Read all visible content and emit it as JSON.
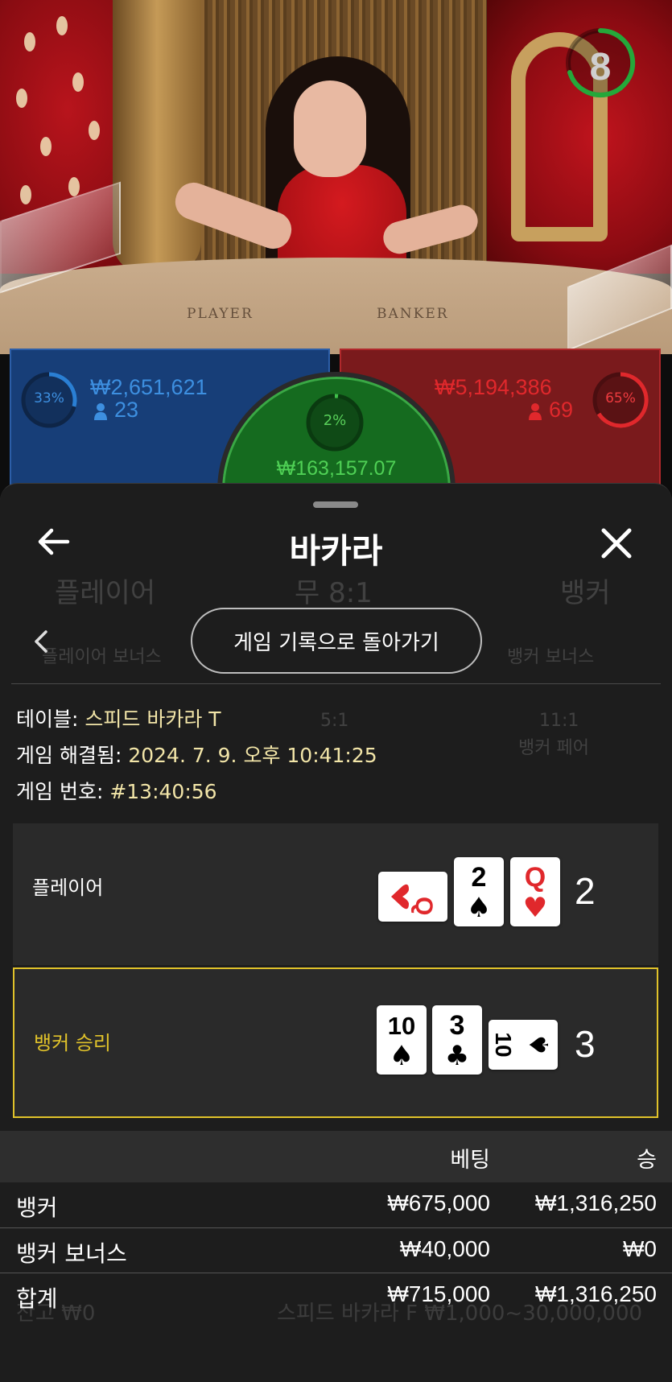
{
  "scene": {
    "timer_value": "8",
    "table_labels": [
      "PLAYER",
      "BANKER"
    ]
  },
  "bets": {
    "player": {
      "percent": "33%",
      "amount": "₩2,651,621",
      "count": "23",
      "color": "#2a7fd4"
    },
    "banker": {
      "percent": "65%",
      "amount": "₩5,194,386",
      "count": "69",
      "color": "#e0282c"
    },
    "tie": {
      "percent": "2%",
      "amount": "₩163,157.07",
      "color": "#3fc04a"
    }
  },
  "background_ghost": {
    "player": "플레이어",
    "tie": "무 8:1",
    "banker": "뱅커",
    "player_bonus": "플레이어 보너스",
    "banker_bonus": "뱅커 보너스",
    "odds_mid": "5:1",
    "odds_right": "11:1",
    "banker_pair": "뱅커 페어",
    "footer_left": "잔고 ₩0",
    "footer_right": "스피드 바카라 F ₩1,000~30,000,000"
  },
  "sheet": {
    "title": "바카라",
    "history_button": "게임 기록으로 돌아가기",
    "table_label": "테이블:",
    "table_value": "스피드 바카라 T",
    "resolved_label": "게임 해결됨:",
    "resolved_value": "2024. 7. 9. 오후 10:41:25",
    "game_no_label": "게임 번호:",
    "game_no_value": "#13:40:56"
  },
  "results": {
    "player": {
      "label": "플레이어",
      "score": "2",
      "cards": [
        {
          "rank": "Q",
          "suit": "♥",
          "orientation": "sideways"
        },
        {
          "rank": "2",
          "suit": "♠",
          "orientation": "upright"
        },
        {
          "rank": "Q",
          "suit": "♥",
          "orientation": "upright"
        }
      ]
    },
    "banker": {
      "label": "뱅커 승리",
      "score": "3",
      "cards": [
        {
          "rank": "10",
          "suit": "♠",
          "orientation": "upright"
        },
        {
          "rank": "3",
          "suit": "♣",
          "orientation": "upright"
        },
        {
          "rank": "10",
          "suit": "♠",
          "orientation": "sideways"
        }
      ]
    }
  },
  "bet_table": {
    "col_bet": "베팅",
    "col_win": "승",
    "rows": [
      {
        "label": "뱅커",
        "bet": "₩675,000",
        "win": "₩1,316,250"
      },
      {
        "label": "뱅커 보너스",
        "bet": "₩40,000",
        "win": "₩0"
      },
      {
        "label": "합계",
        "bet": "₩715,000",
        "win": "₩1,316,250"
      }
    ]
  },
  "colors": {
    "accent_gold": "#e0c22a",
    "info_value": "#f2e5a8",
    "sheet_bg": "#1d1d1d"
  }
}
